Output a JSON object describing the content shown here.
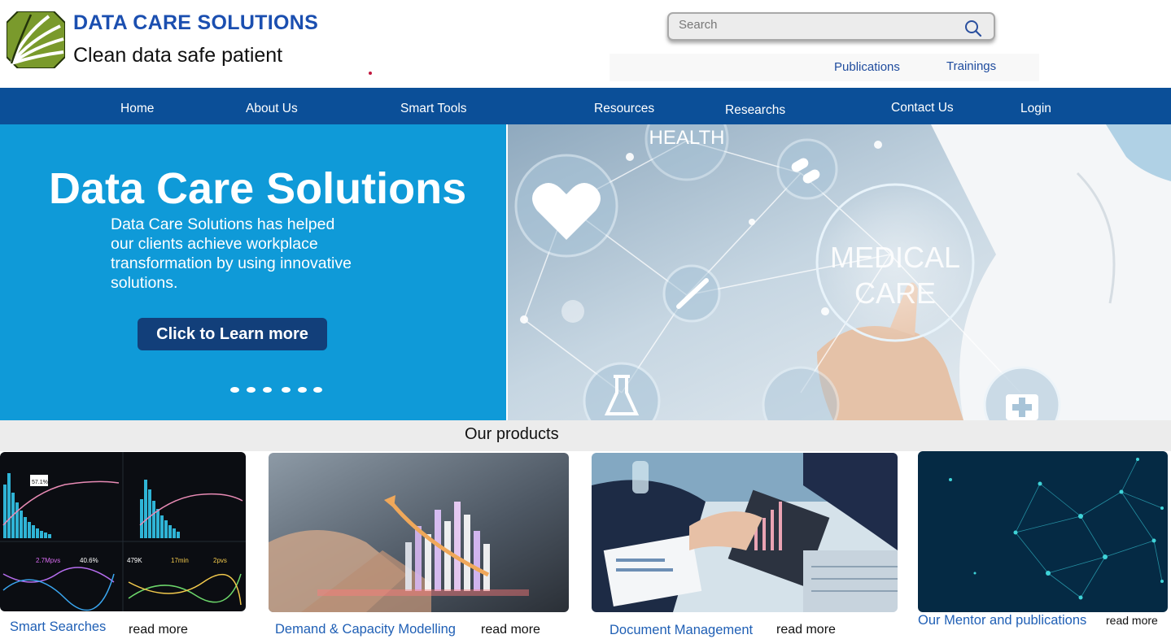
{
  "header": {
    "brand_name": "DATA CARE SOLUTIONS",
    "tagline": "Clean data safe patient",
    "search_placeholder": "Search",
    "links": [
      "Publications",
      "Trainings"
    ]
  },
  "nav": {
    "items": [
      "Home",
      "About Us",
      "Smart Tools",
      "Resources",
      "Researchs",
      "Contact Us",
      "Login"
    ]
  },
  "hero": {
    "title": "Data Care Solutions",
    "description": "Data Care Solutions has helped\n our clients achieve workplace\ntransformation by using innovative\nsolutions.",
    "cta_label": "Click to Learn more",
    "slide_count": 6,
    "image_text": [
      "HEALTH",
      "MEDICAL",
      "CARE"
    ]
  },
  "products": {
    "title": "Our products",
    "cards": [
      {
        "title": "Smart Searches",
        "read_more": "read more",
        "image_labels": [
          "57.1%",
          "2.7Mpvs",
          "40.6%",
          "479K",
          "17min",
          "2pvs"
        ]
      },
      {
        "title": "Demand & Capacity Modelling",
        "read_more": "read more"
      },
      {
        "title": "Document Management",
        "read_more": "read more"
      },
      {
        "title": "Our Mentor and publications",
        "read_more": "read more"
      }
    ]
  },
  "colors": {
    "brand_blue": "#1b4fb0",
    "nav_bg": "#0b4f98",
    "hero_bg": "#0f9ad8",
    "cta_bg": "#123f7a",
    "link_blue": "#1f5fb5",
    "logo_green": "#7a9a2c"
  }
}
